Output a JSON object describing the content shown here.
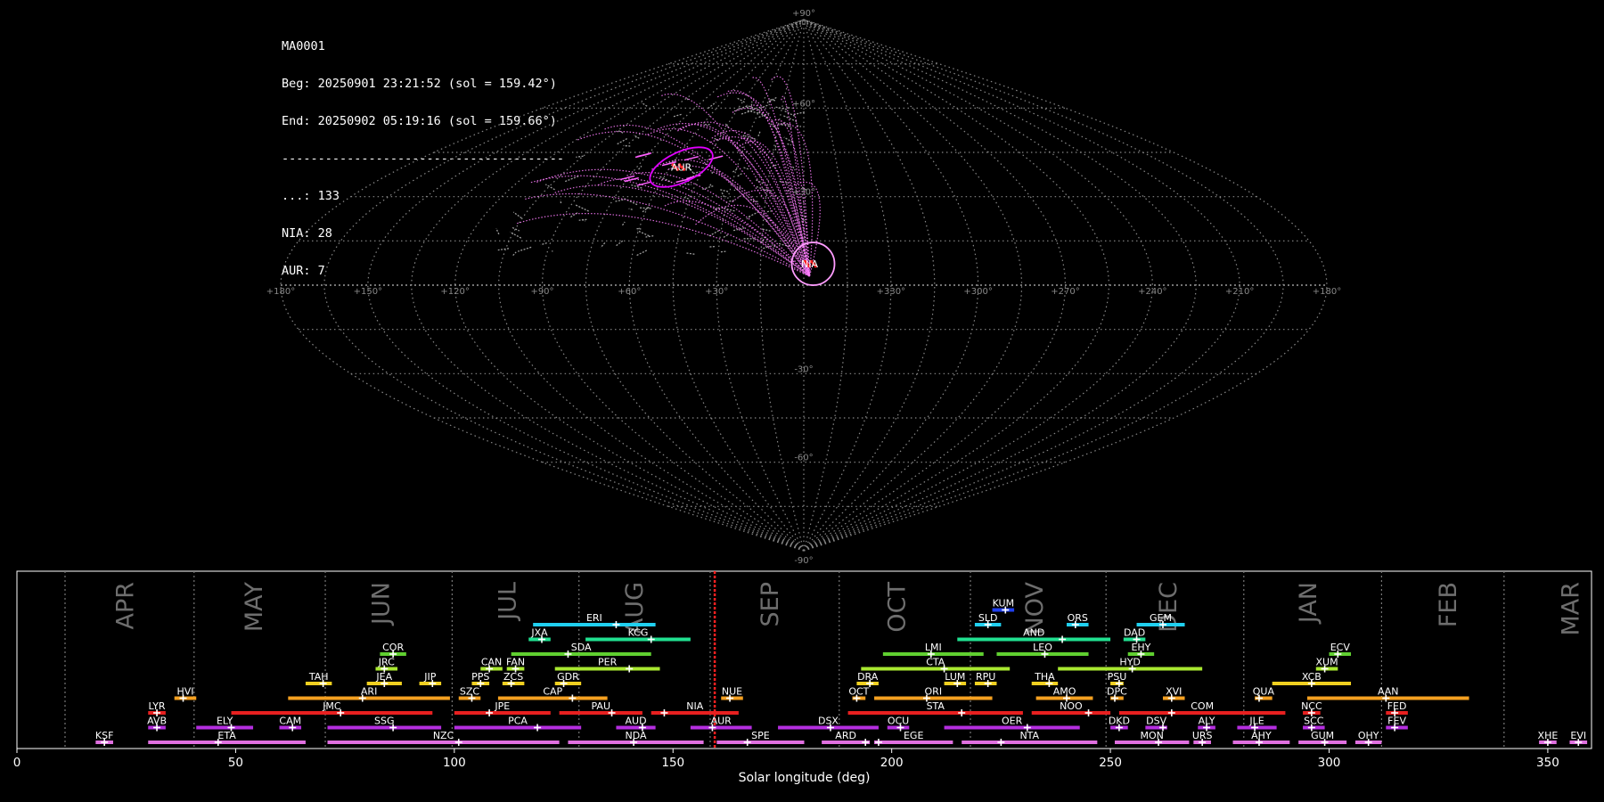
{
  "info": {
    "line1": "MA0001",
    "line2": "Beg: 20250901 23:21:52 (sol = 159.42°)",
    "line3": "End: 20250902 05:19:16 (sol = 159.66°)",
    "line4": "---------------------------------------",
    "line5": "...: 133",
    "line6": "NIA: 28",
    "line7": "AUR: 7"
  },
  "sky_map": {
    "projection": "sinusoidal",
    "lat_labels": [
      "+90°",
      "+60°",
      "+30°",
      "-30°",
      "-60°",
      "-90°"
    ],
    "lat_values": [
      90,
      60,
      30,
      -30,
      -60,
      -90
    ],
    "lon_labels": [
      "+180°",
      "+150°",
      "+120°",
      "+90°",
      "+60°",
      "+30°",
      "+330°",
      "+300°",
      "+270°",
      "+240°",
      "+210°",
      "+180°"
    ],
    "lon_offsets": [
      -180,
      -150,
      -120,
      -90,
      -60,
      -30,
      30,
      60,
      90,
      120,
      150,
      180
    ],
    "radiants": [
      {
        "code": "AUR",
        "lon_offset": -55,
        "lat": 40,
        "color": "#e100ff"
      },
      {
        "code": "NIA",
        "lon_offset": 2,
        "lat": 3,
        "color": "#ff9cff"
      }
    ],
    "grid_color": "#888888",
    "meteor_color_main": "#ff7dff",
    "meteor_color_sporadic": "#9a9a9a"
  },
  "chart_data": {
    "type": "timeline",
    "xlabel": "Solar longitude (deg)",
    "xlim": [
      0,
      360
    ],
    "xticks": [
      0,
      50,
      100,
      150,
      200,
      250,
      300,
      350
    ],
    "current_sol": [
      159.42,
      159.66
    ],
    "months": [
      {
        "label": "APR",
        "start": 11,
        "center": 24.5
      },
      {
        "label": "MAY",
        "start": 40.5,
        "center": 54
      },
      {
        "label": "JUN",
        "start": 70.5,
        "center": 83
      },
      {
        "label": "JUL",
        "start": 99.5,
        "center": 112
      },
      {
        "label": "AUG",
        "start": 128.5,
        "center": 141
      },
      {
        "label": "SEP",
        "start": 158.5,
        "center": 172
      },
      {
        "label": "OCT",
        "start": 188,
        "center": 201
      },
      {
        "label": "NOV",
        "start": 218,
        "center": 232.5
      },
      {
        "label": "DEC",
        "start": 249,
        "center": 263
      },
      {
        "label": "JAN",
        "start": 280.5,
        "center": 295
      },
      {
        "label": "FEB",
        "start": 312,
        "center": 327
      },
      {
        "label": "MAR",
        "start": 340,
        "center": 355
      }
    ],
    "showers": [
      {
        "code": "KSF",
        "start": 18,
        "end": 22,
        "peak": 20,
        "row": 0,
        "color": "#e070e0"
      },
      {
        "code": "ETA",
        "start": 30,
        "end": 66,
        "peak": 46,
        "row": 0,
        "color": "#e070e0"
      },
      {
        "code": "NZC",
        "start": 71,
        "end": 124,
        "peak": 101,
        "row": 0,
        "color": "#e070e0"
      },
      {
        "code": "NDA",
        "start": 126,
        "end": 157,
        "peak": 141,
        "row": 0,
        "color": "#e070e0"
      },
      {
        "code": "SPE",
        "start": 160,
        "end": 180,
        "peak": 167,
        "row": 0,
        "color": "#e070e0"
      },
      {
        "code": "ARD",
        "start": 184,
        "end": 195,
        "peak": 194,
        "row": 0,
        "color": "#e070e0"
      },
      {
        "code": "EGE",
        "start": 196,
        "end": 214,
        "peak": 197,
        "row": 0,
        "color": "#e070e0"
      },
      {
        "code": "NTA",
        "start": 216,
        "end": 247,
        "peak": 225,
        "row": 0,
        "color": "#e070e0"
      },
      {
        "code": "MON",
        "start": 251,
        "end": 268,
        "peak": 261,
        "row": 0,
        "color": "#e070e0"
      },
      {
        "code": "URS",
        "start": 269,
        "end": 273,
        "peak": 271,
        "row": 0,
        "color": "#e070e0"
      },
      {
        "code": "AHY",
        "start": 278,
        "end": 291,
        "peak": 284,
        "row": 0,
        "color": "#e070e0"
      },
      {
        "code": "GUM",
        "start": 293,
        "end": 304,
        "peak": 299,
        "row": 0,
        "color": "#e070e0"
      },
      {
        "code": "OHY",
        "start": 306,
        "end": 312,
        "peak": 309,
        "row": 0,
        "color": "#e070e0"
      },
      {
        "code": "XHE",
        "start": 348,
        "end": 352,
        "peak": 350,
        "row": 0,
        "color": "#e070e0"
      },
      {
        "code": "EVI",
        "start": 355,
        "end": 359,
        "peak": 357,
        "row": 0,
        "color": "#e070e0"
      },
      {
        "code": "AVB",
        "start": 30,
        "end": 34,
        "peak": 32,
        "row": 1,
        "color": "#b52ee0"
      },
      {
        "code": "ELY",
        "start": 41,
        "end": 54,
        "peak": 49,
        "row": 1,
        "color": "#b52ee0"
      },
      {
        "code": "CAM",
        "start": 60,
        "end": 65,
        "peak": 63,
        "row": 1,
        "color": "#b52ee0"
      },
      {
        "code": "SSG",
        "start": 71,
        "end": 97,
        "peak": 86,
        "row": 1,
        "color": "#b52ee0"
      },
      {
        "code": "PCA",
        "start": 100,
        "end": 129,
        "peak": 119,
        "row": 1,
        "color": "#b52ee0"
      },
      {
        "code": "AUD",
        "start": 137,
        "end": 146,
        "peak": 143,
        "row": 1,
        "color": "#b52ee0"
      },
      {
        "code": "AUR",
        "start": 154,
        "end": 168,
        "peak": 159,
        "row": 1,
        "color": "#b52ee0"
      },
      {
        "code": "DSX",
        "start": 174,
        "end": 197,
        "peak": 186,
        "row": 1,
        "color": "#b52ee0"
      },
      {
        "code": "OCU",
        "start": 199,
        "end": 204,
        "peak": 202,
        "row": 1,
        "color": "#b52ee0"
      },
      {
        "code": "OER",
        "start": 212,
        "end": 243,
        "peak": 231,
        "row": 1,
        "color": "#b52ee0"
      },
      {
        "code": "DKD",
        "start": 250,
        "end": 254,
        "peak": 252,
        "row": 1,
        "color": "#b52ee0"
      },
      {
        "code": "DSV",
        "start": 258,
        "end": 263,
        "peak": 262,
        "row": 1,
        "color": "#b52ee0"
      },
      {
        "code": "ALY",
        "start": 270,
        "end": 274,
        "peak": 272,
        "row": 1,
        "color": "#b52ee0"
      },
      {
        "code": "JLE",
        "start": 279,
        "end": 288,
        "peak": 283,
        "row": 1,
        "color": "#b52ee0"
      },
      {
        "code": "SCC",
        "start": 294,
        "end": 299,
        "peak": 296,
        "row": 1,
        "color": "#b52ee0"
      },
      {
        "code": "FEV",
        "start": 313,
        "end": 318,
        "peak": 315,
        "row": 1,
        "color": "#b52ee0"
      },
      {
        "code": "LYR",
        "start": 30,
        "end": 34,
        "peak": 32,
        "row": 2,
        "color": "#e82020"
      },
      {
        "code": "JMC",
        "start": 49,
        "end": 95,
        "peak": 74,
        "row": 2,
        "color": "#e82020"
      },
      {
        "code": "JPE",
        "start": 100,
        "end": 122,
        "peak": 108,
        "row": 2,
        "color": "#e82020"
      },
      {
        "code": "PAU",
        "start": 124,
        "end": 143,
        "peak": 136,
        "row": 2,
        "color": "#e82020"
      },
      {
        "code": "NIA",
        "start": 145,
        "end": 165,
        "peak": 148,
        "row": 2,
        "color": "#e82020"
      },
      {
        "code": "STA",
        "start": 190,
        "end": 230,
        "peak": 216,
        "row": 2,
        "color": "#e82020"
      },
      {
        "code": "NOO",
        "start": 232,
        "end": 250,
        "peak": 245,
        "row": 2,
        "color": "#e82020"
      },
      {
        "code": "COM",
        "start": 252,
        "end": 290,
        "peak": 264,
        "row": 2,
        "color": "#e82020"
      },
      {
        "code": "NCC",
        "start": 294,
        "end": 298,
        "peak": 296,
        "row": 2,
        "color": "#e82020"
      },
      {
        "code": "FED",
        "start": 313,
        "end": 318,
        "peak": 315,
        "row": 2,
        "color": "#e82020"
      },
      {
        "code": "HVI",
        "start": 36,
        "end": 41,
        "peak": 38,
        "row": 3,
        "color": "#f5a020"
      },
      {
        "code": "ARI",
        "start": 62,
        "end": 99,
        "peak": 79,
        "row": 3,
        "color": "#f5a020"
      },
      {
        "code": "SZC",
        "start": 101,
        "end": 106,
        "peak": 104,
        "row": 3,
        "color": "#f5a020"
      },
      {
        "code": "CAP",
        "start": 110,
        "end": 135,
        "peak": 127,
        "row": 3,
        "color": "#f5a020"
      },
      {
        "code": "NUE",
        "start": 161,
        "end": 166,
        "peak": 163,
        "row": 3,
        "color": "#f5a020"
      },
      {
        "code": "OCT",
        "start": 191,
        "end": 194,
        "peak": 192,
        "row": 3,
        "color": "#f5a020"
      },
      {
        "code": "ORI",
        "start": 196,
        "end": 223,
        "peak": 208,
        "row": 3,
        "color": "#f5a020"
      },
      {
        "code": "AMO",
        "start": 233,
        "end": 246,
        "peak": 240,
        "row": 3,
        "color": "#f5a020"
      },
      {
        "code": "DPC",
        "start": 250,
        "end": 253,
        "peak": 251,
        "row": 3,
        "color": "#f5a020"
      },
      {
        "code": "XVI",
        "start": 262,
        "end": 267,
        "peak": 264,
        "row": 3,
        "color": "#f5a020"
      },
      {
        "code": "QUA",
        "start": 283,
        "end": 287,
        "peak": 284,
        "row": 3,
        "color": "#f5a020"
      },
      {
        "code": "AAN",
        "start": 295,
        "end": 332,
        "peak": 313,
        "row": 3,
        "color": "#f5a020"
      },
      {
        "code": "TAH",
        "start": 66,
        "end": 72,
        "peak": 70,
        "row": 4,
        "color": "#f0d020"
      },
      {
        "code": "JEA",
        "start": 80,
        "end": 88,
        "peak": 84,
        "row": 4,
        "color": "#f0d020"
      },
      {
        "code": "JIP",
        "start": 92,
        "end": 97,
        "peak": 95,
        "row": 4,
        "color": "#f0d020"
      },
      {
        "code": "PPS",
        "start": 104,
        "end": 108,
        "peak": 106,
        "row": 4,
        "color": "#f0d020"
      },
      {
        "code": "ZCS",
        "start": 111,
        "end": 116,
        "peak": 113,
        "row": 4,
        "color": "#f0d020"
      },
      {
        "code": "GDR",
        "start": 123,
        "end": 129,
        "peak": 125,
        "row": 4,
        "color": "#f0d020"
      },
      {
        "code": "DRA",
        "start": 192,
        "end": 197,
        "peak": 195,
        "row": 4,
        "color": "#f0d020"
      },
      {
        "code": "LUM",
        "start": 212,
        "end": 217,
        "peak": 215,
        "row": 4,
        "color": "#f0d020"
      },
      {
        "code": "RPU",
        "start": 219,
        "end": 224,
        "peak": 222,
        "row": 4,
        "color": "#f0d020"
      },
      {
        "code": "THA",
        "start": 232,
        "end": 238,
        "peak": 236,
        "row": 4,
        "color": "#f0d020"
      },
      {
        "code": "PSU",
        "start": 250,
        "end": 253,
        "peak": 252,
        "row": 4,
        "color": "#f0d020"
      },
      {
        "code": "XCB",
        "start": 287,
        "end": 305,
        "peak": 296,
        "row": 4,
        "color": "#f0d020"
      },
      {
        "code": "JRC",
        "start": 82,
        "end": 87,
        "peak": 84,
        "row": 5,
        "color": "#a8e830"
      },
      {
        "code": "CAN",
        "start": 106,
        "end": 111,
        "peak": 108,
        "row": 5,
        "color": "#a8e830"
      },
      {
        "code": "FAN",
        "start": 112,
        "end": 116,
        "peak": 114,
        "row": 5,
        "color": "#a8e830"
      },
      {
        "code": "PER",
        "start": 123,
        "end": 147,
        "peak": 140,
        "row": 5,
        "color": "#a8e830"
      },
      {
        "code": "CTA",
        "start": 193,
        "end": 227,
        "peak": 212,
        "row": 5,
        "color": "#a8e830"
      },
      {
        "code": "HYD",
        "start": 238,
        "end": 271,
        "peak": 255,
        "row": 5,
        "color": "#a8e830"
      },
      {
        "code": "XUM",
        "start": 297,
        "end": 302,
        "peak": 299,
        "row": 5,
        "color": "#a8e830"
      },
      {
        "code": "COR",
        "start": 83,
        "end": 89,
        "peak": 86,
        "row": 6,
        "color": "#60d030"
      },
      {
        "code": "SDA",
        "start": 113,
        "end": 145,
        "peak": 126,
        "row": 6,
        "color": "#60d030"
      },
      {
        "code": "LMI",
        "start": 198,
        "end": 221,
        "peak": 209,
        "row": 6,
        "color": "#60d030"
      },
      {
        "code": "LEO",
        "start": 224,
        "end": 245,
        "peak": 235,
        "row": 6,
        "color": "#60d030"
      },
      {
        "code": "EHY",
        "start": 254,
        "end": 260,
        "peak": 257,
        "row": 6,
        "color": "#60d030"
      },
      {
        "code": "ECV",
        "start": 300,
        "end": 305,
        "peak": 302,
        "row": 6,
        "color": "#60d030"
      },
      {
        "code": "JXA",
        "start": 117,
        "end": 122,
        "peak": 120,
        "row": 7,
        "color": "#20e090"
      },
      {
        "code": "KCG",
        "start": 130,
        "end": 154,
        "peak": 145,
        "row": 7,
        "color": "#20e090"
      },
      {
        "code": "AND",
        "start": 215,
        "end": 250,
        "peak": 239,
        "row": 7,
        "color": "#20e090"
      },
      {
        "code": "DAD",
        "start": 253,
        "end": 258,
        "peak": 256,
        "row": 7,
        "color": "#20e090"
      },
      {
        "code": "ERI",
        "start": 118,
        "end": 146,
        "peak": 137,
        "row": 8,
        "color": "#20d0f0"
      },
      {
        "code": "SLD",
        "start": 219,
        "end": 225,
        "peak": 222,
        "row": 8,
        "color": "#20d0f0"
      },
      {
        "code": "ORS",
        "start": 240,
        "end": 245,
        "peak": 242,
        "row": 8,
        "color": "#20d0f0"
      },
      {
        "code": "GEM",
        "start": 256,
        "end": 267,
        "peak": 262,
        "row": 8,
        "color": "#20d0f0"
      },
      {
        "code": "KUM",
        "start": 223,
        "end": 228,
        "peak": 226,
        "row": 9,
        "color": "#2040f0"
      }
    ]
  }
}
